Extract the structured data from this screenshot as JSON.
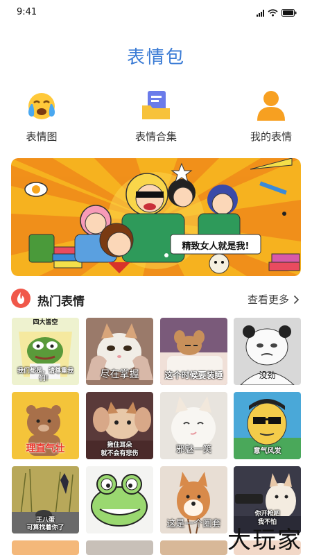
{
  "status": {
    "time": "9:41"
  },
  "title": "表情包",
  "categories": [
    {
      "label": "表情图",
      "icon": "crying-face-icon"
    },
    {
      "label": "表情合集",
      "icon": "folder-collection-icon"
    },
    {
      "label": "我的表情",
      "icon": "user-profile-icon"
    }
  ],
  "banner": {
    "caption": "精致女人就是我!"
  },
  "hot": {
    "title": "热门表情",
    "more": "查看更多"
  },
  "stickers": [
    {
      "caption": "四大皆空",
      "caption2": "我们都是，请尊重我们！"
    },
    {
      "caption": "尽在掌握"
    },
    {
      "caption": "这个时候要装睡"
    },
    {
      "caption": "没劲"
    },
    {
      "caption": "理直气壮"
    },
    {
      "caption": "揪住耳朵",
      "caption2": "就不会有悲伤"
    },
    {
      "caption": "邪魅一笑"
    },
    {
      "caption": "意气风发"
    },
    {
      "caption": "王八蛋",
      "caption2": "可算找着你了"
    },
    {
      "caption": ""
    },
    {
      "caption": "这是一个圈套"
    },
    {
      "caption": "你开枪吧",
      "caption2": "我不怕"
    }
  ],
  "watermark": "大玩家",
  "colors": {
    "accent": "#3a7bd5",
    "hot": "#f0584a",
    "bannerBg": "#f7a21b"
  }
}
